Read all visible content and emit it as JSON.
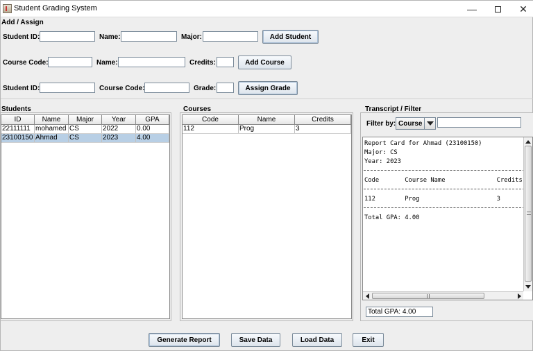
{
  "window": {
    "title": "Student Grading System"
  },
  "add_assign": {
    "title": "Add / Assign",
    "row1": {
      "student_id_label": "Student ID:",
      "name_label": "Name:",
      "major_label": "Major:",
      "button": "Add Student",
      "student_id": "",
      "name": "",
      "major": ""
    },
    "row2": {
      "course_code_label": "Course Code:",
      "name_label": "Name:",
      "credits_label": "Credits:",
      "button": "Add Course",
      "course_code": "",
      "name": "",
      "credits": ""
    },
    "row3": {
      "student_id_label": "Student ID:",
      "course_code_label": "Course Code:",
      "grade_label": "Grade:",
      "button": "Assign Grade",
      "student_id": "",
      "course_code": "",
      "grade": ""
    }
  },
  "students": {
    "title": "Students",
    "columns": [
      "ID",
      "Name",
      "Major",
      "Year",
      "GPA"
    ],
    "rows": [
      [
        "22111111",
        "mohamed",
        "CS",
        "2022",
        "0.00"
      ],
      [
        "23100150",
        "Ahmad",
        "CS",
        "2023",
        "4.00"
      ]
    ],
    "selected_row": 1
  },
  "courses": {
    "title": "Courses",
    "columns": [
      "Code",
      "Name",
      "Credits"
    ],
    "rows": [
      [
        "112",
        "Prog",
        "3"
      ]
    ]
  },
  "transcript": {
    "title": "Transcript / Filter",
    "filter_label": "Filter by:",
    "filter_value": "Course",
    "filter_text": "",
    "lines": [
      "Report Card for Ahmad (23100150)",
      "Major: CS",
      "Year: 2023",
      "Code       Course Name              Credits",
      "112        Prog                     3",
      "Total GPA: 4.00"
    ],
    "total_gpa": "Total GPA: 4.00"
  },
  "footer": {
    "generate_report": "Generate Report",
    "save_data": "Save Data",
    "load_data": "Load Data",
    "exit": "Exit"
  }
}
